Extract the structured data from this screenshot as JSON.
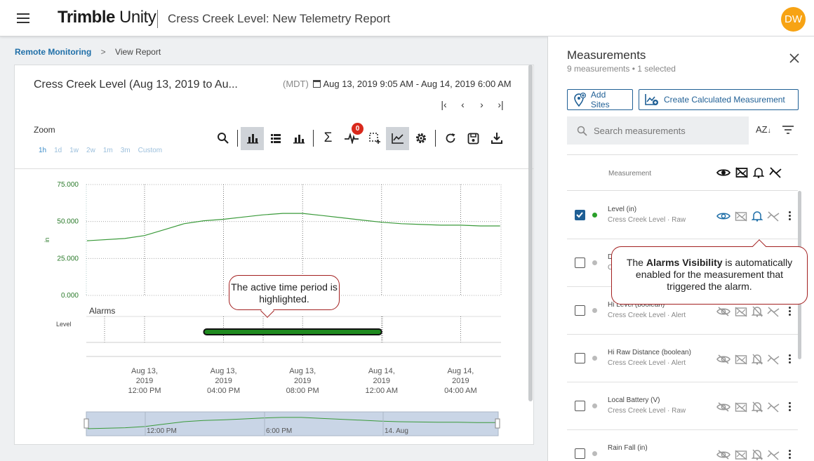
{
  "header": {
    "brand_bold": "Trimble",
    "brand_light": " Unity",
    "title": "Cress Creek Level: New Telemetry Report",
    "avatar_initials": "DW"
  },
  "breadcrumb": {
    "parent": "Remote Monitoring",
    "separator": ">",
    "current": "View Report"
  },
  "chart_card": {
    "title": "Cress Creek Level (Aug 13, 2019 to Au...",
    "timezone": "(MDT)",
    "date_range": "Aug 13, 2019 9:05 AM - Aug 14, 2019 6:00 AM",
    "zoom_label": "Zoom",
    "zoom_options": [
      "1h",
      "1d",
      "1w",
      "2w",
      "1m",
      "3m",
      "Custom"
    ],
    "event_badge": "0",
    "alarms_label": "Alarms",
    "alarm_row_label": "Level"
  },
  "chart_data": {
    "type": "line",
    "ylabel": "in",
    "ylim": [
      0,
      75000
    ],
    "y_ticks": [
      "75.000",
      "50.000",
      "25.000",
      "0.000"
    ],
    "x_ticks": [
      [
        "Aug 13,",
        "2019",
        "12:00 PM"
      ],
      [
        "Aug 13,",
        "2019",
        "04:00 PM"
      ],
      [
        "Aug 13,",
        "2019",
        "08:00 PM"
      ],
      [
        "Aug 14,",
        "2019",
        "12:00 AM"
      ],
      [
        "Aug 14,",
        "2019",
        "04:00 AM"
      ]
    ],
    "series": [
      {
        "x": [
          "Aug 13 9:05 AM",
          "Aug 13 11:00 AM",
          "Aug 13 12:00 PM",
          "Aug 13 1:00 PM",
          "Aug 13 2:00 PM",
          "Aug 13 3:00 PM",
          "Aug 13 4:00 PM",
          "Aug 13 5:00 PM",
          "Aug 13 6:00 PM",
          "Aug 13 7:00 PM",
          "Aug 13 8:00 PM",
          "Aug 13 9:00 PM",
          "Aug 13 10:00 PM",
          "Aug 13 11:00 PM",
          "Aug 14 12:00 AM",
          "Aug 14 1:00 AM",
          "Aug 14 2:00 AM",
          "Aug 14 3:00 AM",
          "Aug 14 4:00 AM",
          "Aug 14 5:00 AM",
          "Aug 14 6:00 AM"
        ],
        "values": [
          37000,
          38500,
          40500,
          44500,
          48500,
          50500,
          51500,
          53000,
          54500,
          55500,
          55500,
          54000,
          52500,
          51000,
          49500,
          48500,
          48000,
          47500,
          47500,
          47000,
          47000
        ]
      }
    ],
    "grid": true,
    "alarm_active_from": "Aug 13 3:00 PM",
    "alarm_active_to": "Aug 14 12:00 AM",
    "navigator_labels": [
      "12:00 PM",
      "6:00 PM",
      "14. Aug"
    ],
    "colors": {
      "line": "#3a9a3a",
      "alarm": "#1f8a1f",
      "navigator_fill": "#c9d5e6"
    }
  },
  "callouts": {
    "active_period": "The active time period is highlighted.",
    "alarms_pre": "The ",
    "alarms_bold": "Alarms Visibility",
    "alarms_post": " is automatically enabled for the measurement that triggered the alarm."
  },
  "panel": {
    "title": "Measurements",
    "subtitle": "9 measurements • 1 selected",
    "add_sites_label": "Add Sites",
    "calc_label": "Create Calculated Measurement",
    "search_placeholder": "Search measurements",
    "sort_label": "AZ",
    "column_header": "Measurement",
    "rows": [
      {
        "name": "Level (in)",
        "sub": "Cress Creek Level · Raw",
        "checked": true,
        "dot": "#2aa02a",
        "active": true
      },
      {
        "name": "D",
        "sub": "C",
        "checked": false,
        "dot": "#bbb",
        "active": false
      },
      {
        "name": "Hi Level (boolean)",
        "sub": "Cress Creek Level · Alert",
        "checked": false,
        "dot": "#bbb",
        "active": false
      },
      {
        "name": "Hi Raw Distance (boolean)",
        "sub": "Cress Creek Level · Alert",
        "checked": false,
        "dot": "#bbb",
        "active": false
      },
      {
        "name": "Local Battery (V)",
        "sub": "Cress Creek Level · Raw",
        "checked": false,
        "dot": "#bbb",
        "active": false
      },
      {
        "name": "Rain Fall (in)",
        "sub": "",
        "checked": false,
        "dot": "#bbb",
        "active": false
      }
    ]
  },
  "colors": {
    "accent": "#1f5f95",
    "avatar": "#f7a314",
    "callout_border": "#a32020",
    "badge": "#d9291c"
  }
}
